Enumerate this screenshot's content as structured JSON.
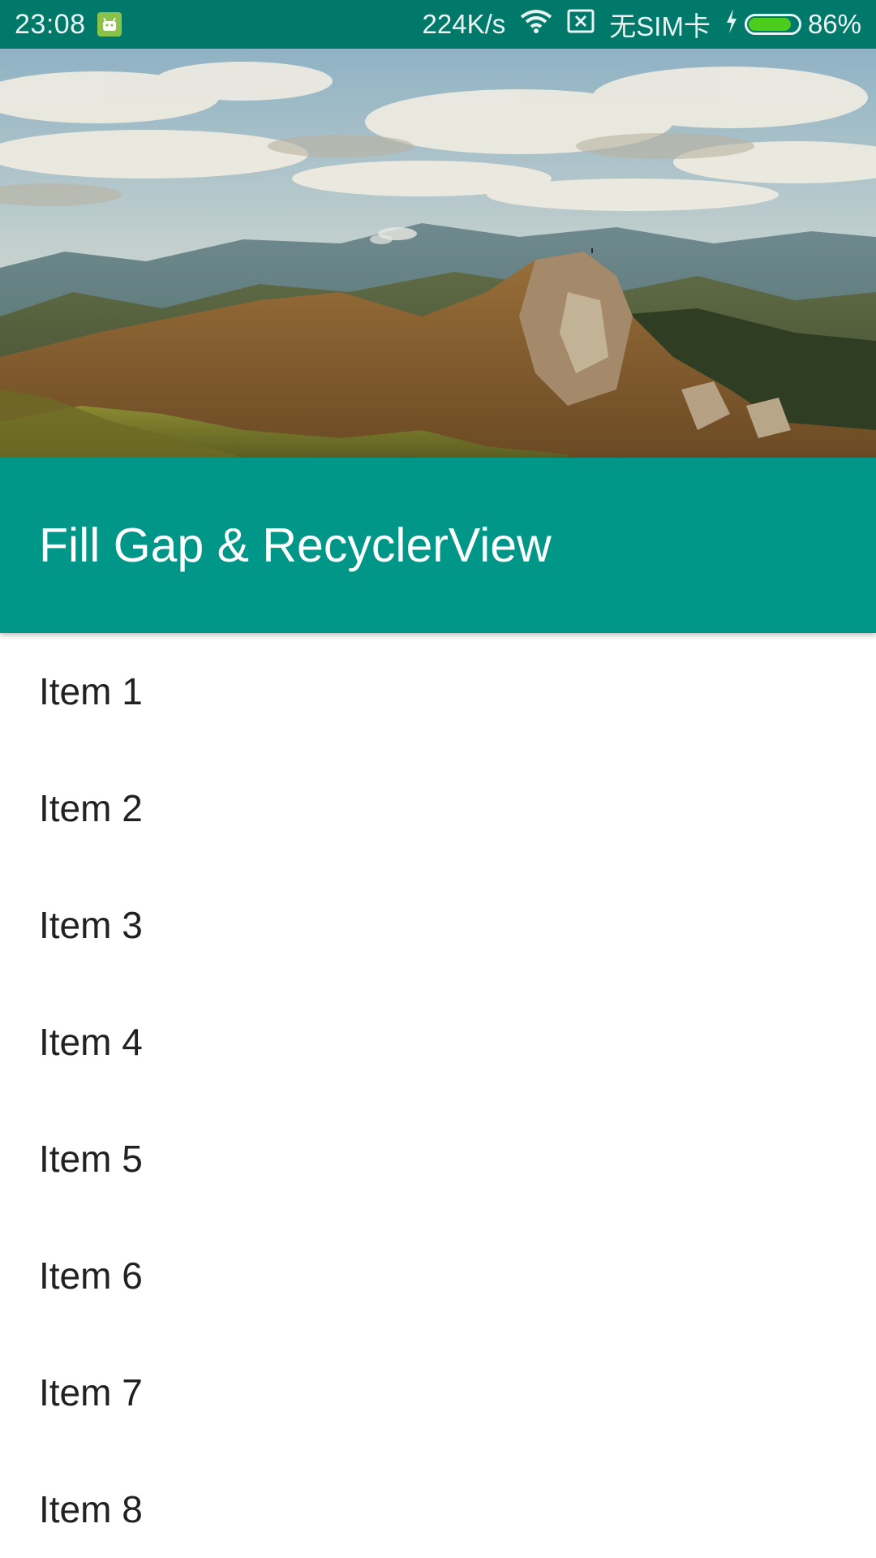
{
  "status_bar": {
    "time": "23:08",
    "network_speed": "224K/s",
    "sim_status": "无SIM卡",
    "battery_percent": "86%",
    "battery_level": 0.86,
    "icons": [
      "android-notification-icon",
      "wifi-icon",
      "no-sim-icon",
      "charging-icon",
      "battery-icon"
    ]
  },
  "header": {
    "image": "mountain-landscape"
  },
  "toolbar": {
    "title": "Fill Gap & RecyclerView"
  },
  "list": {
    "items": [
      {
        "label": "Item 1"
      },
      {
        "label": "Item 2"
      },
      {
        "label": "Item 3"
      },
      {
        "label": "Item 4"
      },
      {
        "label": "Item 5"
      },
      {
        "label": "Item 6"
      },
      {
        "label": "Item 7"
      },
      {
        "label": "Item 8"
      }
    ]
  },
  "colors": {
    "status_bar": "#00796b",
    "toolbar": "#009688",
    "list_background": "#ffffff",
    "list_text": "#212121",
    "battery_fill": "#4ccd1c"
  }
}
